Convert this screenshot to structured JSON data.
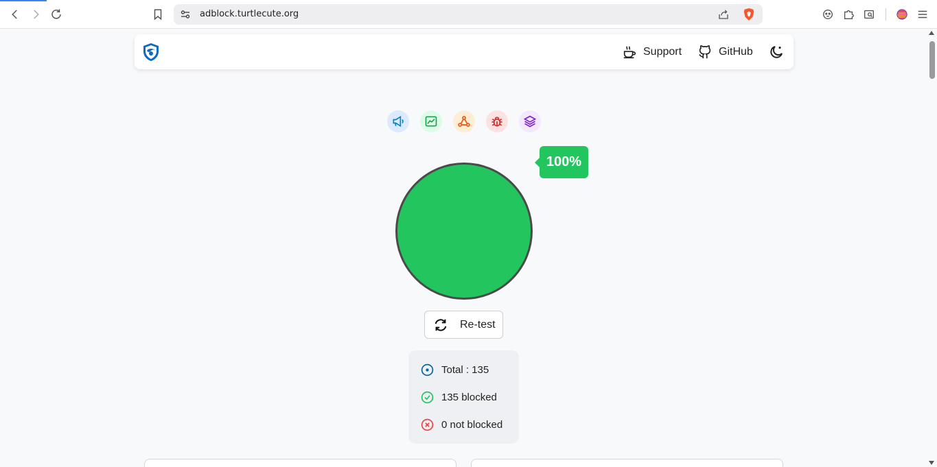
{
  "browser": {
    "url": "adblock.turtlecute.org",
    "icons": [
      "back-icon",
      "forward-icon",
      "reload-icon",
      "bookmark-icon",
      "site-settings-icon",
      "share-icon",
      "brave-shields-icon",
      "extension-icon",
      "puzzle-icon",
      "reader-icon",
      "wallet-icon",
      "menu-icon"
    ]
  },
  "header": {
    "support_label": "Support",
    "github_label": "GitHub"
  },
  "categories": [
    {
      "name": "ads",
      "color": "#0284c7",
      "bg": "#dbeafe"
    },
    {
      "name": "analytics",
      "color": "#16a34a",
      "bg": "#dcfce7"
    },
    {
      "name": "error-trackers",
      "color": "#ea580c",
      "bg": "#ffedd5"
    },
    {
      "name": "bug-trackers",
      "color": "#dc2626",
      "bg": "#fee2e2"
    },
    {
      "name": "social-trackers",
      "color": "#7e22ce",
      "bg": "#f3e8ff"
    }
  ],
  "result": {
    "score": "100%",
    "color": "#22c55e",
    "retest_label": "Re-test"
  },
  "stats": {
    "total": "Total : 135",
    "blocked": "135 blocked",
    "not_blocked": "0 not blocked",
    "total_color": "#0369a1",
    "blocked_color": "#22c55e",
    "not_blocked_color": "#ef4444"
  }
}
